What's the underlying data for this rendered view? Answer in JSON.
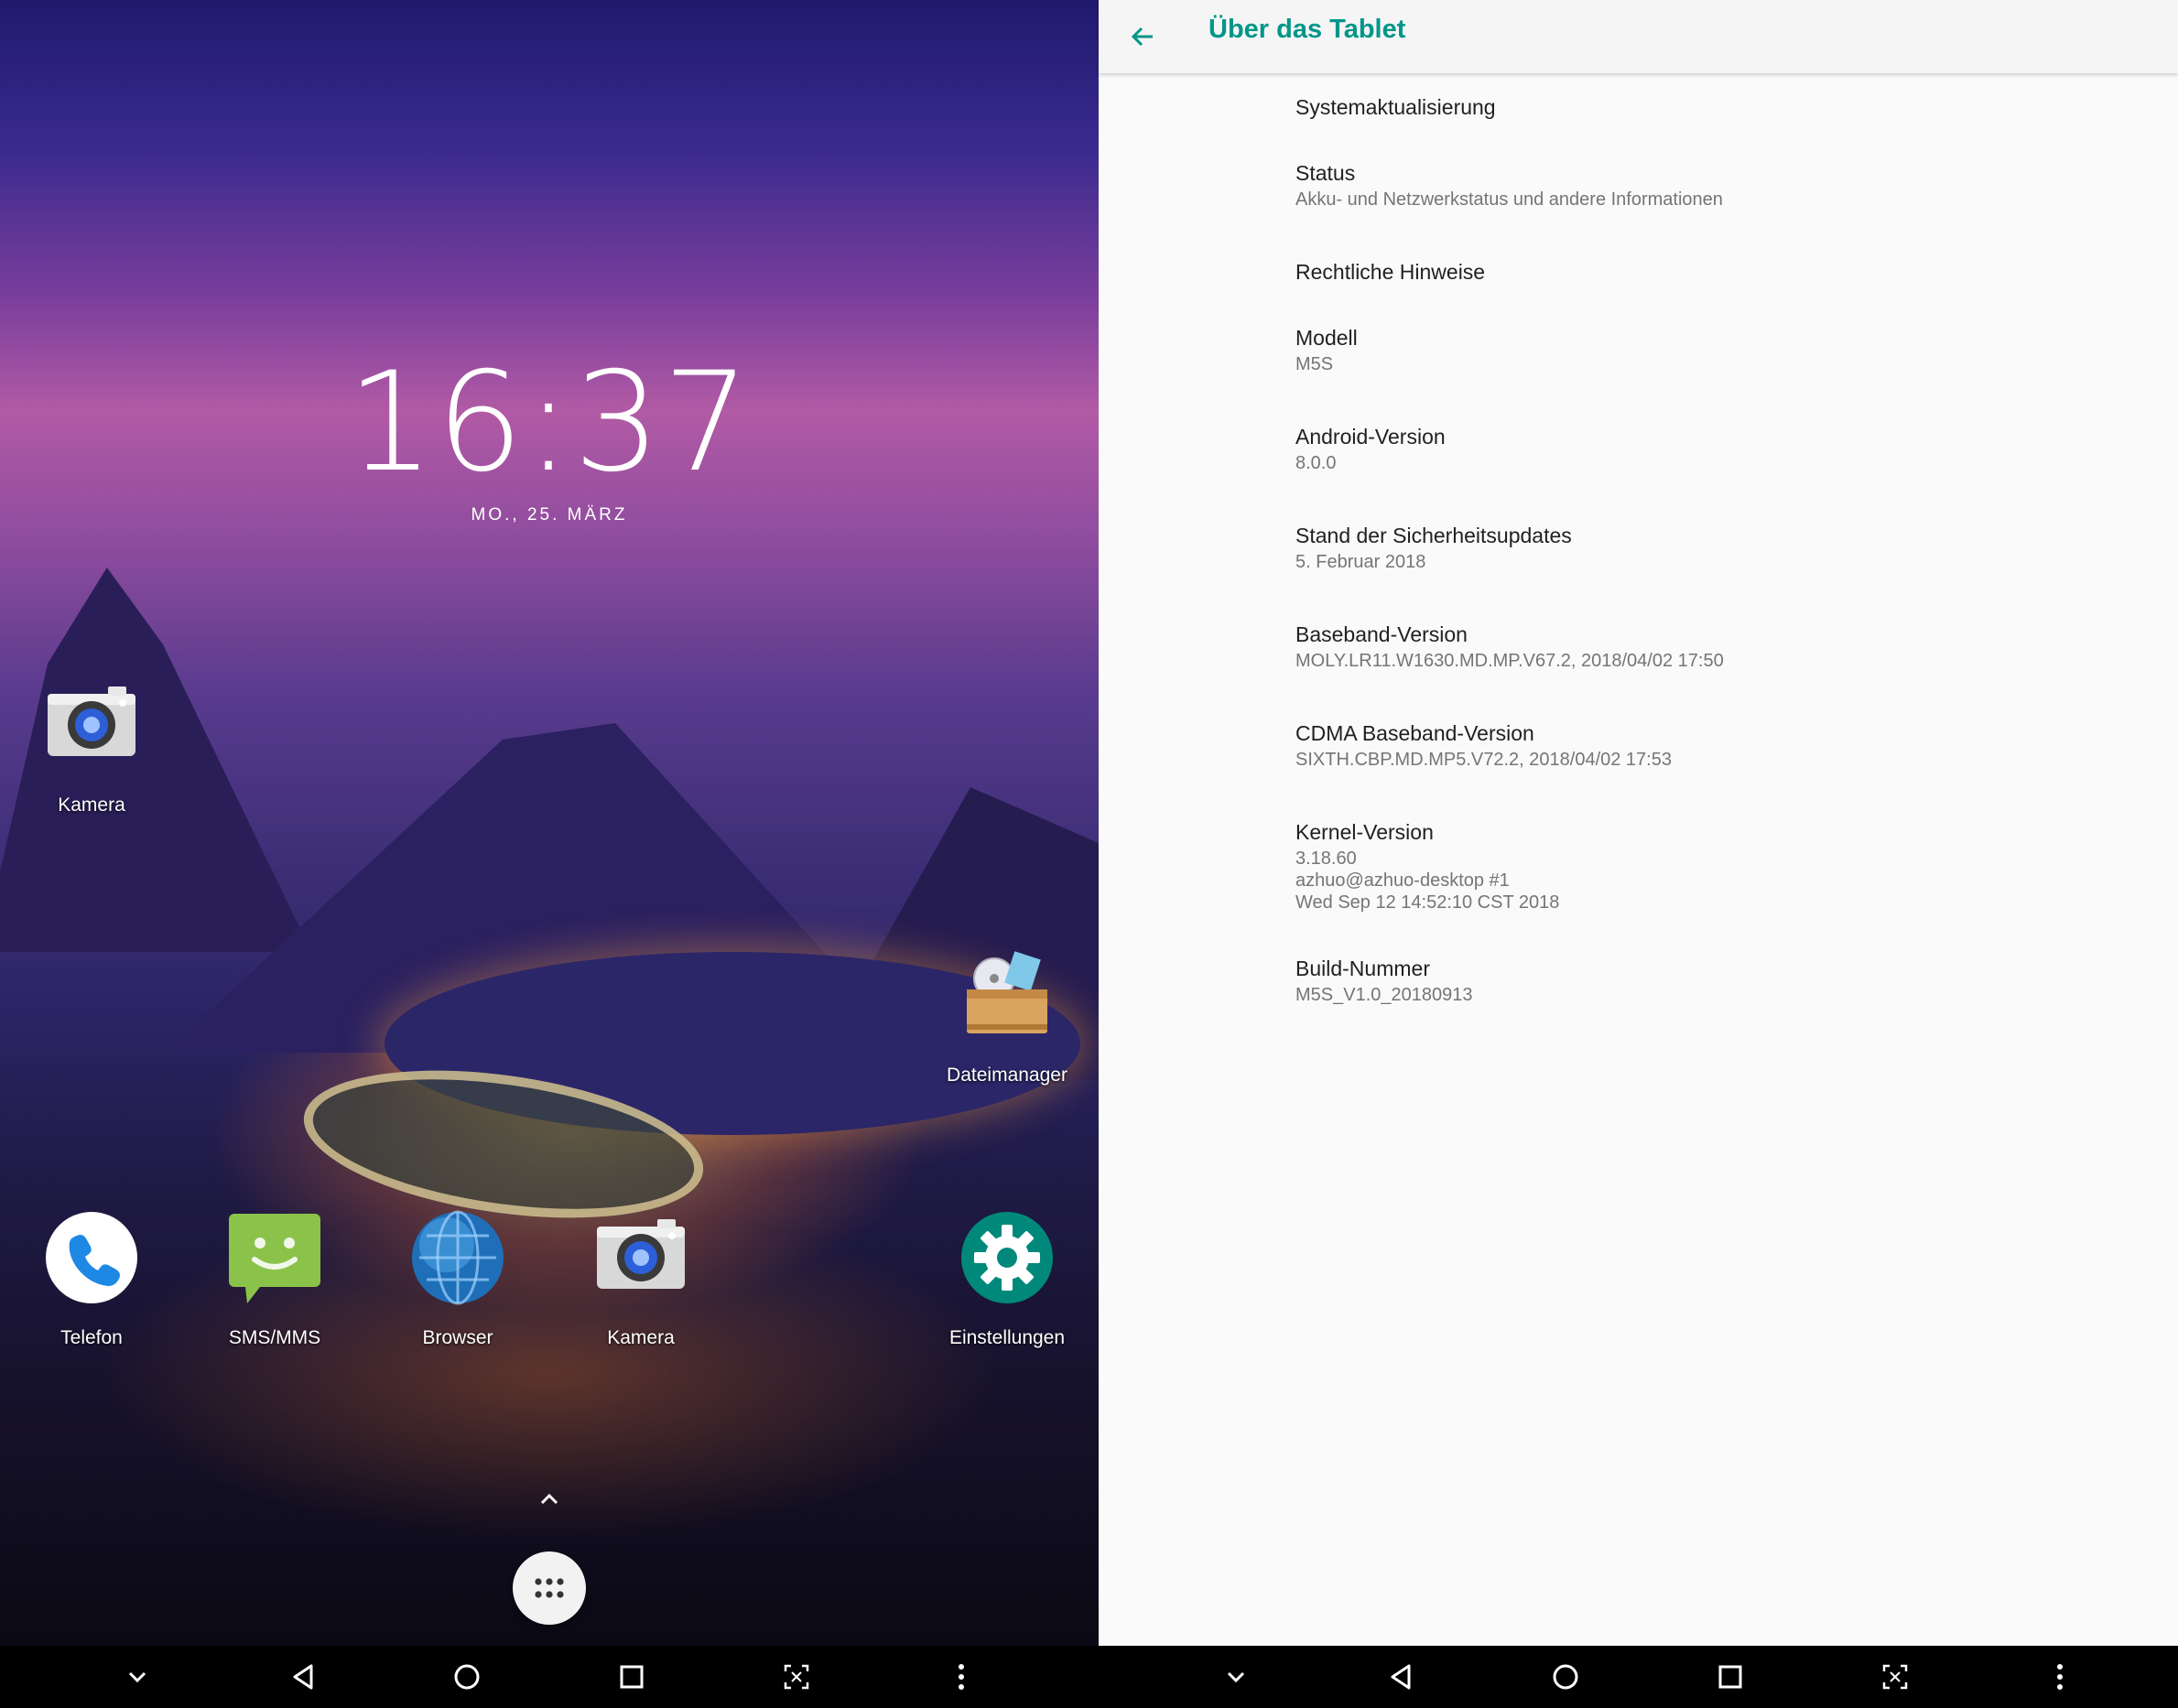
{
  "home": {
    "clock": "16:37",
    "date": "MO., 25. MÄRZ",
    "apps": [
      {
        "label": "Kamera",
        "icon": "camera-icon"
      },
      {
        "label": "Dateimanager",
        "icon": "file-manager-icon"
      },
      {
        "label": "Telefon",
        "icon": "phone-icon"
      },
      {
        "label": "SMS/MMS",
        "icon": "sms-icon"
      },
      {
        "label": "Browser",
        "icon": "browser-globe-icon"
      },
      {
        "label": "Kamera",
        "icon": "camera-icon"
      },
      {
        "label": "Einstellungen",
        "icon": "settings-gear-icon"
      }
    ]
  },
  "settings": {
    "title": "Über das Tablet",
    "items": [
      {
        "title": "Systemaktualisierung",
        "summary": ""
      },
      {
        "title": "Status",
        "summary": "Akku- und Netzwerkstatus und andere Informationen"
      },
      {
        "title": "Rechtliche Hinweise",
        "summary": ""
      },
      {
        "title": "Modell",
        "summary": "M5S"
      },
      {
        "title": "Android-Version",
        "summary": "8.0.0"
      },
      {
        "title": "Stand der Sicherheitsupdates",
        "summary": "5. Februar 2018"
      },
      {
        "title": "Baseband-Version",
        "summary": "MOLY.LR11.W1630.MD.MP.V67.2, 2018/04/02 17:50"
      },
      {
        "title": "CDMA Baseband-Version",
        "summary": "SIXTH.CBP.MD.MP5.V72.2, 2018/04/02 17:53"
      },
      {
        "title": "Kernel-Version",
        "summary": "3.18.60\nazhuo@azhuo-desktop #1\nWed Sep 12 14:52:10 CST 2018"
      },
      {
        "title": "Build-Nummer",
        "summary": "M5S_V1.0_20180913"
      }
    ]
  },
  "navbar": {
    "icons": [
      "hide-navbar-chevron-icon",
      "back-triangle-icon",
      "home-circle-icon",
      "recents-square-icon",
      "screenshot-icon",
      "more-vert-icon"
    ]
  },
  "colors": {
    "accent": "#009688",
    "settings_background": "#fafafa",
    "navbar": "#000000"
  }
}
